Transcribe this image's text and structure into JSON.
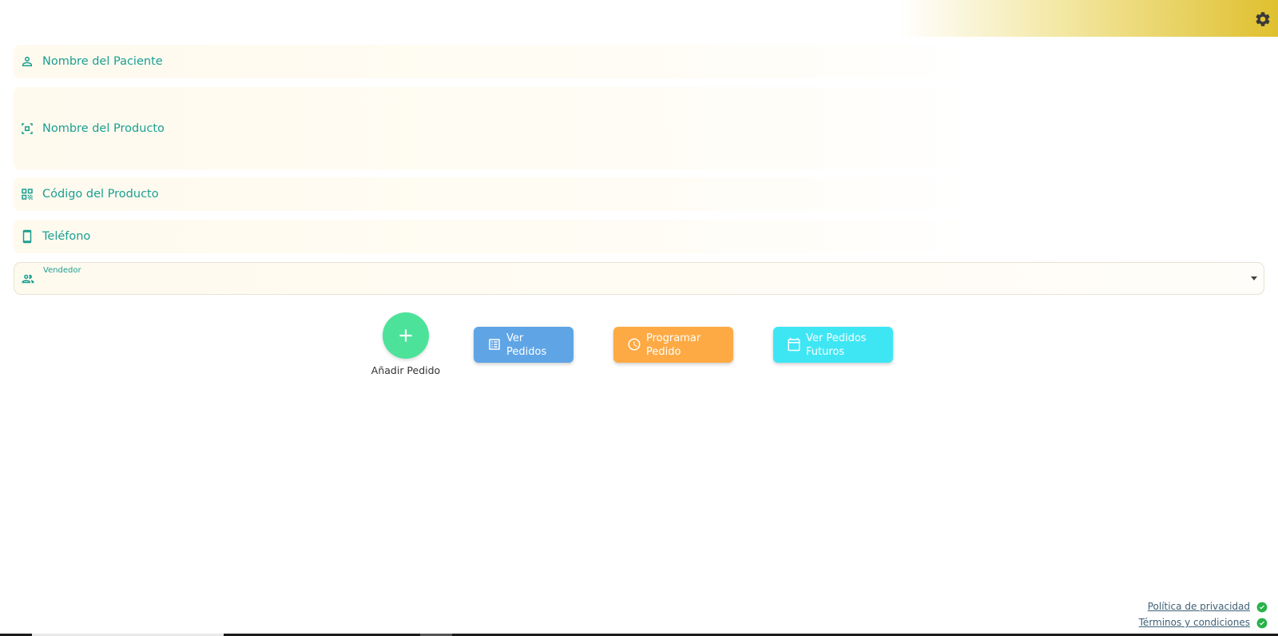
{
  "header": {
    "settings_icon": "gear-icon",
    "accent_color": "#dfc02e"
  },
  "form": {
    "patient_name_label": "Nombre del Paciente",
    "product_name_label": "Nombre del Producto",
    "product_code_label": "Código del Producto",
    "phone_label": "Teléfono",
    "seller_label": "Vendedor",
    "seller_value": "",
    "field_text_color": "#1a9f92"
  },
  "actions": {
    "add_order_label": "Añadir Pedido",
    "view_orders_label": "Ver Pedidos",
    "schedule_order_label": "Programar Pedido",
    "future_orders_label": "Ver Pedidos Futuros",
    "add_color": "#4de29a",
    "view_color": "#5fa5e6",
    "schedule_color": "#fdaa44",
    "future_color": "#3ee6f4"
  },
  "footer": {
    "privacy_label": "Política de privacidad",
    "terms_label": "Términos y condiciones"
  }
}
